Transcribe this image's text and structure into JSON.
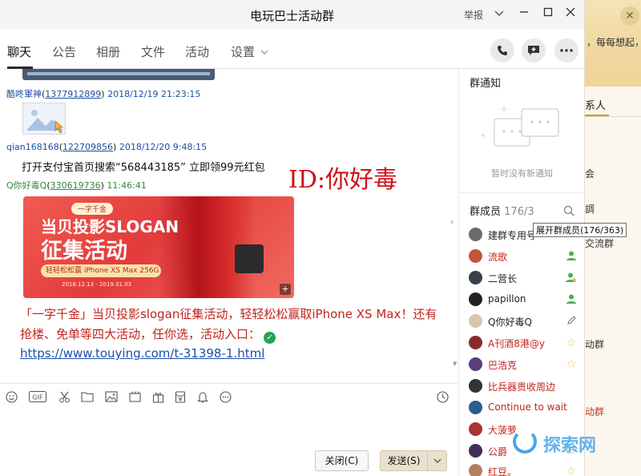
{
  "window": {
    "title": "电玩巴士活动群",
    "report_label": "举报"
  },
  "tabs": [
    {
      "label": "聊天"
    },
    {
      "label": "公告"
    },
    {
      "label": "相册"
    },
    {
      "label": "文件"
    },
    {
      "label": "活动"
    },
    {
      "label": "设置"
    }
  ],
  "messages": [
    {
      "nick": "酷咚軍神",
      "qq": "1377912899",
      "time": "2018/12/19 21:23:15"
    },
    {
      "nick": "qian168168",
      "qq": "122709856",
      "time": "2018/12/20 9:48:15",
      "text": "打开支付宝首页搜索“568443185” 立即领99元红包"
    },
    {
      "nick": "Q你好毒Q",
      "qq": "330619736",
      "time": "11:46:41"
    }
  ],
  "overlay_text": "ID:你好毒",
  "promo": {
    "tag": "一字千金",
    "line1": "当贝投影SLOGAN",
    "line2": "征集活动",
    "line3": "轻轻松松赢 iPhone XS Max 256G",
    "line4": "2018.12.13 - 2019.01.03"
  },
  "red_message": {
    "line1": "「一字千金」当贝投影slogan征集活动，轻轻松松赢取iPhone XS Max！还有",
    "line2": "抢楼、免单等四大活动，任你选，活动入口："
  },
  "link": "https://www.touying.com/t-31398-1.html",
  "buttons": {
    "close": "关闭(C)",
    "send": "发送(S)"
  },
  "notice": {
    "title": "群通知",
    "empty": "暂时没有新通知"
  },
  "members": {
    "title_prefix": "群成员",
    "count_shown": "176/3",
    "tooltip": "展开群成员(176/363)",
    "list": [
      {
        "name": "建群专用号",
        "color": "#222222"
      },
      {
        "name": "流歌",
        "color": "#c0241d"
      },
      {
        "name": "二营长",
        "color": "#222222"
      },
      {
        "name": "papillon",
        "color": "#222222"
      },
      {
        "name": "Q你好毒Q",
        "color": "#222222"
      },
      {
        "name": "A刊酒8港@y",
        "color": "#c0241d"
      },
      {
        "name": "巴浩克",
        "color": "#c0241d"
      },
      {
        "name": "比兵器贵收周边",
        "color": "#c0241d"
      },
      {
        "name": "Continue to wait",
        "color": "#c0241d"
      },
      {
        "name": "大菠萝",
        "color": "#c0241d"
      },
      {
        "name": "公爵",
        "color": "#c0241d"
      },
      {
        "name": "红豆。",
        "color": "#c0241d"
      }
    ]
  },
  "background_window": {
    "banner_text": "，每每想起，",
    "tab": "系人",
    "rows": [
      "会",
      "調",
      "交流群",
      "动群",
      "动群"
    ]
  },
  "site_watermark": "探索网",
  "colors": {
    "accent_red": "#c0241d",
    "link_blue": "#1b4fb0",
    "meta_blue": "#1d4fa0",
    "meta_green": "#2e8b3a"
  }
}
